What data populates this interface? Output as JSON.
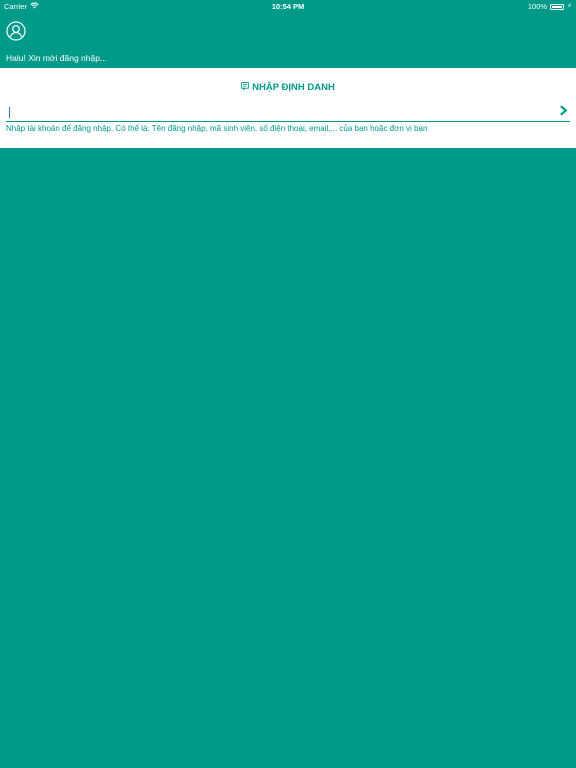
{
  "status_bar": {
    "carrier": "Carrier",
    "time": "10:54 PM",
    "battery_level": "100%",
    "wifi_icon": "wifi-icon",
    "battery_icon": "battery-icon",
    "charging_icon": "charging-bolt-icon"
  },
  "header": {
    "avatar_icon": "user-avatar-icon",
    "greeting": "Halu! Xin mời đăng nhập..."
  },
  "login_panel": {
    "title_icon": "id-card-icon",
    "title": "NHẬP ĐỊNH DANH",
    "input_value": "",
    "submit_icon": "chevron-right-icon",
    "hint": "Nhập tài khoản để đăng nhập. Có thể là: Tên đăng nhập, mã sinh viên, số điện thoại, email,... của bạn hoặc đơn vị bạn"
  },
  "colors": {
    "primary": "#009a88",
    "panel_background": "#ffffff",
    "caret": "#2f6fe0"
  }
}
